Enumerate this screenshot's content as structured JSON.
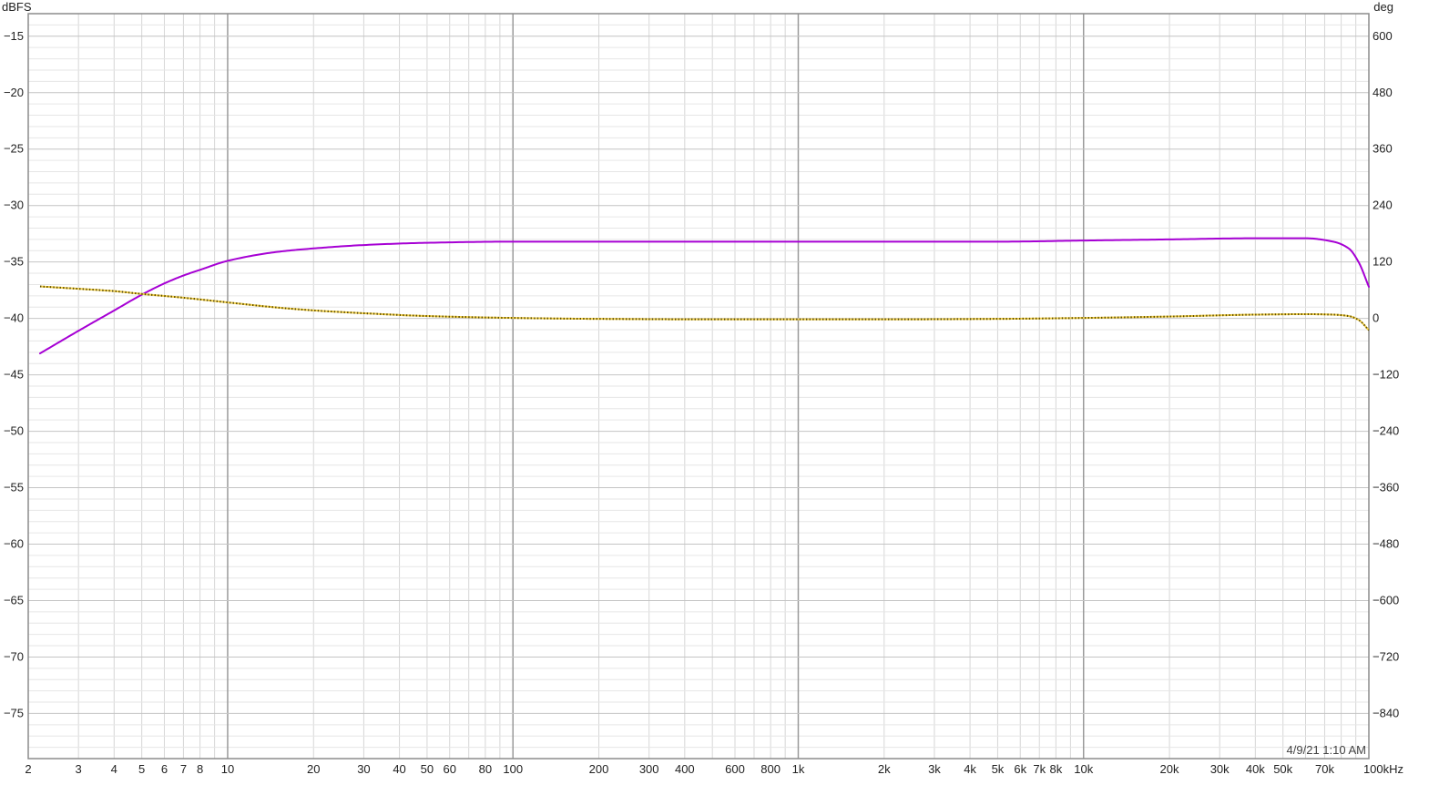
{
  "chart_data": {
    "type": "line",
    "title": "",
    "left_axis_unit": "dBFS",
    "right_axis_unit": "deg",
    "x_scale": "log",
    "xlim": [
      2,
      100000
    ],
    "ylim": [
      -79,
      -13
    ],
    "y2lim": [
      -936,
      648
    ],
    "grid": true,
    "legend": "none",
    "timestamp": "4/9/21 1:10 AM",
    "x_ticks": [
      {
        "value": 2,
        "label": "2"
      },
      {
        "value": 3,
        "label": "3"
      },
      {
        "value": 4,
        "label": "4"
      },
      {
        "value": 5,
        "label": "5"
      },
      {
        "value": 6,
        "label": "6"
      },
      {
        "value": 7,
        "label": "7"
      },
      {
        "value": 8,
        "label": "8"
      },
      {
        "value": 10,
        "label": "10"
      },
      {
        "value": 20,
        "label": "20"
      },
      {
        "value": 30,
        "label": "30"
      },
      {
        "value": 40,
        "label": "40"
      },
      {
        "value": 50,
        "label": "50"
      },
      {
        "value": 60,
        "label": "60"
      },
      {
        "value": 80,
        "label": "80"
      },
      {
        "value": 100,
        "label": "100"
      },
      {
        "value": 200,
        "label": "200"
      },
      {
        "value": 300,
        "label": "300"
      },
      {
        "value": 400,
        "label": "400"
      },
      {
        "value": 600,
        "label": "600"
      },
      {
        "value": 800,
        "label": "800"
      },
      {
        "value": 1000,
        "label": "1k"
      },
      {
        "value": 2000,
        "label": "2k"
      },
      {
        "value": 3000,
        "label": "3k"
      },
      {
        "value": 4000,
        "label": "4k"
      },
      {
        "value": 5000,
        "label": "5k"
      },
      {
        "value": 6000,
        "label": "6k"
      },
      {
        "value": 7000,
        "label": "7k"
      },
      {
        "value": 8000,
        "label": "8k"
      },
      {
        "value": 10000,
        "label": "10k"
      },
      {
        "value": 20000,
        "label": "20k"
      },
      {
        "value": 30000,
        "label": "30k"
      },
      {
        "value": 40000,
        "label": "40k"
      },
      {
        "value": 50000,
        "label": "50k"
      },
      {
        "value": 70000,
        "label": "70k"
      },
      {
        "value": 100000,
        "label": "100kHz"
      }
    ],
    "y_ticks": [
      -15,
      -20,
      -25,
      -30,
      -35,
      -40,
      -45,
      -50,
      -55,
      -60,
      -65,
      -70,
      -75
    ],
    "y2_ticks": [
      600,
      480,
      360,
      240,
      120,
      0,
      -120,
      -240,
      -360,
      -480,
      -600,
      -720,
      -840
    ],
    "colors": {
      "magnitude": "#a600d4",
      "phase": "#5a4a00",
      "phase_dots": "#f2d04a"
    },
    "series": [
      {
        "axis": "left",
        "unit": "dBFS",
        "style": "solid",
        "color": "#a600d4",
        "x": [
          2.2,
          3,
          4,
          5,
          6,
          7,
          8,
          10,
          15,
          20,
          30,
          50,
          100,
          200,
          500,
          1000,
          2000,
          5000,
          10000,
          20000,
          40000,
          60000,
          75000,
          85000,
          92000,
          100000
        ],
        "y": [
          -43.1,
          -41.1,
          -39.3,
          -37.9,
          -36.9,
          -36.2,
          -35.7,
          -34.9,
          -34.1,
          -33.8,
          -33.5,
          -33.3,
          -33.2,
          -33.2,
          -33.2,
          -33.2,
          -33.2,
          -33.2,
          -33.1,
          -33.0,
          -32.9,
          -32.9,
          -33.2,
          -33.8,
          -35.0,
          -37.2
        ]
      },
      {
        "axis": "right",
        "unit": "deg",
        "style": "dotted",
        "color": "#5a4a00",
        "x": [
          2.2,
          3,
          4,
          5,
          7,
          10,
          15,
          20,
          30,
          50,
          100,
          200,
          500,
          1000,
          2000,
          5000,
          10000,
          20000,
          40000,
          60000,
          75000,
          85000,
          92000,
          100000
        ],
        "y": [
          68,
          63,
          58,
          52,
          44,
          34,
          23,
          17,
          11,
          5,
          1,
          -1,
          -2,
          -2,
          -2,
          -1,
          1,
          4,
          8,
          9,
          8,
          5,
          -3,
          -25
        ]
      }
    ]
  }
}
